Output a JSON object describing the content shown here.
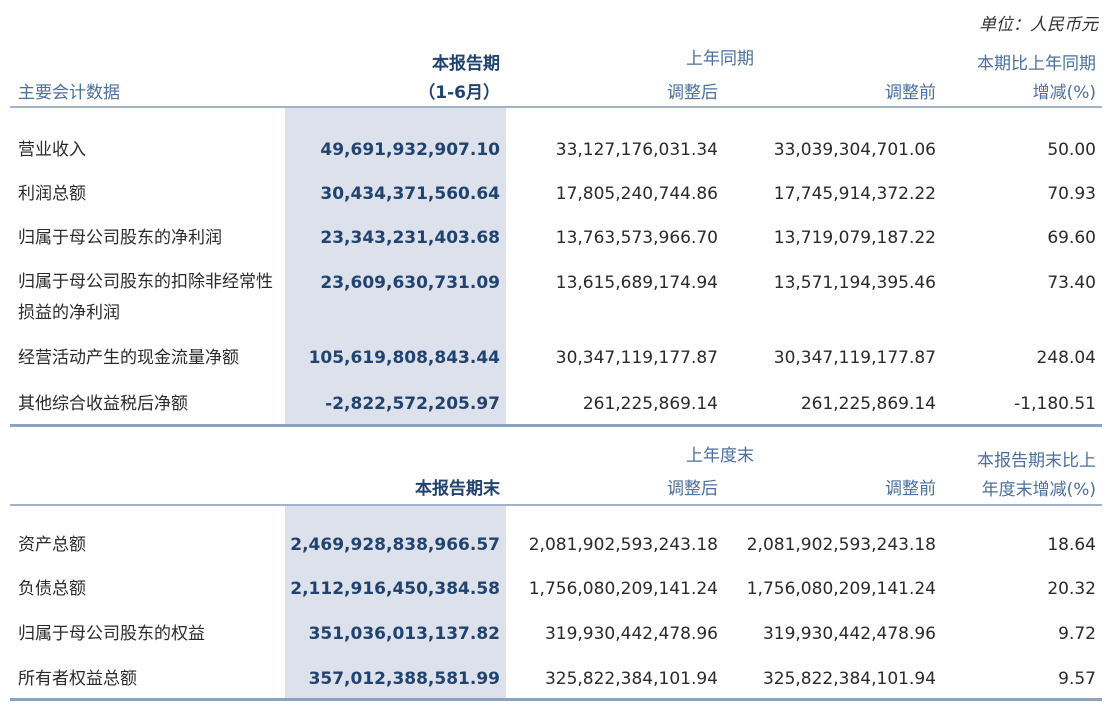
{
  "unit_label": "单位：人民币元",
  "section1": {
    "headers": {
      "label": "主要会计数据",
      "current_line1": "本报告期",
      "current_line2": "（1-6月）",
      "prior_group": "上年同期",
      "adjusted_after": "调整后",
      "adjusted_before": "调整前",
      "change_line1": "本期比上年同期",
      "change_line2": "增减(%)"
    },
    "rows": [
      {
        "label": "营业收入",
        "current": "49,691,932,907.10",
        "after": "33,127,176,031.34",
        "before": "33,039,304,701.06",
        "change": "50.00"
      },
      {
        "label": "利润总额",
        "current": "30,434,371,560.64",
        "after": "17,805,240,744.86",
        "before": "17,745,914,372.22",
        "change": "70.93"
      },
      {
        "label": "归属于母公司股东的净利润",
        "current": "23,343,231,403.68",
        "after": "13,763,573,966.70",
        "before": "13,719,079,187.22",
        "change": "69.60"
      },
      {
        "label": "归属于母公司股东的扣除非经常性损益的净利润",
        "current": "23,609,630,731.09",
        "after": "13,615,689,174.94",
        "before": "13,571,194,395.46",
        "change": "73.40"
      },
      {
        "label": "经营活动产生的现金流量净额",
        "current": "105,619,808,843.44",
        "after": "30,347,119,177.87",
        "before": "30,347,119,177.87",
        "change": "248.04"
      },
      {
        "label": "其他综合收益税后净额",
        "current": "-2,822,572,205.97",
        "after": "261,225,869.14",
        "before": "261,225,869.14",
        "change": "-1,180.51"
      }
    ]
  },
  "section2": {
    "headers": {
      "current": "本报告期末",
      "prior_group": "上年度末",
      "adjusted_after": "调整后",
      "adjusted_before": "调整前",
      "change_line1": "本报告期末比上",
      "change_line2": "年度末增减(%)"
    },
    "rows": [
      {
        "label": "资产总额",
        "current": "2,469,928,838,966.57",
        "after": "2,081,902,593,243.18",
        "before": "2,081,902,593,243.18",
        "change": "18.64"
      },
      {
        "label": "负债总额",
        "current": "2,112,916,450,384.58",
        "after": "1,756,080,209,141.24",
        "before": "1,756,080,209,141.24",
        "change": "20.32"
      },
      {
        "label": "归属于母公司股东的权益",
        "current": "351,036,013,137.82",
        "after": "319,930,442,478.96",
        "before": "319,930,442,478.96",
        "change": "9.72"
      },
      {
        "label": "所有者权益总额",
        "current": "357,012,388,581.99",
        "after": "325,822,384,101.94",
        "before": "325,822,384,101.94",
        "change": "9.57"
      }
    ]
  }
}
